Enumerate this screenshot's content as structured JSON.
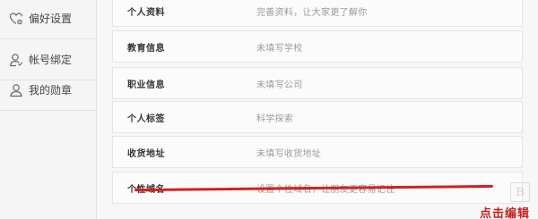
{
  "sidebar": {
    "items": [
      {
        "label": "偏好设置",
        "icon": "heart-settings-icon"
      },
      {
        "label": "帐号绑定",
        "icon": "user-icon"
      },
      {
        "label": "我的勋章",
        "icon": "user-icon"
      }
    ]
  },
  "profile_rows": [
    {
      "label": "个人资料",
      "value": "完善资料，让大家更了解你"
    },
    {
      "label": "教育信息",
      "value": "未填写学校"
    },
    {
      "label": "职业信息",
      "value": "未填写公司"
    },
    {
      "label": "个人标签",
      "value": "科学探索"
    },
    {
      "label": "收货地址",
      "value": "未填写收货地址"
    },
    {
      "label": "个性域名",
      "value": "设置个性域名，让朋友更容易记住"
    }
  ],
  "annotation": {
    "text": "点击编辑",
    "color": "#d42020"
  },
  "watermark": {
    "glyph": "B"
  }
}
